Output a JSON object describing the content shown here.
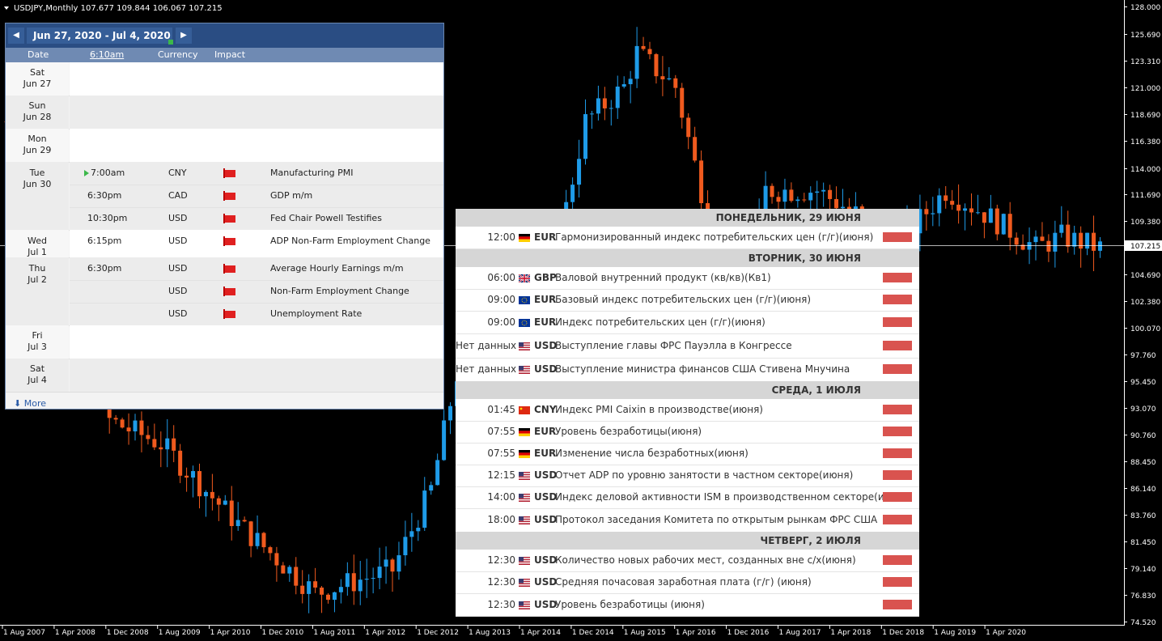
{
  "chart": {
    "header": "USDJPY,Monthly  107.677 109.844 106.067 107.215",
    "current_price": "107.215",
    "price_ticks": [
      "128.000",
      "125.690",
      "123.310",
      "121.000",
      "118.690",
      "116.380",
      "114.000",
      "111.690",
      "109.380",
      "107.215",
      "104.690",
      "102.380",
      "100.070",
      "97.760",
      "95.450",
      "93.070",
      "90.760",
      "88.450",
      "86.140",
      "83.760",
      "81.450",
      "79.140",
      "76.830",
      "74.520"
    ],
    "date_ticks": [
      "1 Aug 2007",
      "1 Apr 2008",
      "1 Dec 2008",
      "1 Aug 2009",
      "1 Apr 2010",
      "1 Dec 2010",
      "1 Aug 2011",
      "1 Apr 2012",
      "1 Dec 2012",
      "1 Aug 2013",
      "1 Apr 2014",
      "1 Dec 2014",
      "1 Aug 2015",
      "1 Apr 2016",
      "1 Dec 2016",
      "1 Aug 2017",
      "1 Apr 2018",
      "1 Dec 2018",
      "1 Aug 2019",
      "1 Apr 2020"
    ],
    "colors": {
      "bull": "#1e9be8",
      "bear": "#f05a1e",
      "price_line": "#ffffff",
      "bg": "#000000"
    }
  },
  "calendar_left": {
    "range": "Jun 27, 2020 - Jul 4, 2020",
    "nav_prev": "◀",
    "nav_next": "▶",
    "columns": {
      "date": "Date",
      "time": "6:10am",
      "currency": "Currency",
      "impact": "Impact"
    },
    "days": [
      {
        "dow": "Sat",
        "date": "Jun 27",
        "events": []
      },
      {
        "dow": "Sun",
        "date": "Jun 28",
        "events": []
      },
      {
        "dow": "Mon",
        "date": "Jun 29",
        "events": []
      },
      {
        "dow": "Tue",
        "date": "Jun 30",
        "events": [
          {
            "time": "7:00am",
            "currency": "CNY",
            "title": "Manufacturing PMI",
            "next": true
          },
          {
            "time": "6:30pm",
            "currency": "CAD",
            "title": "GDP m/m"
          },
          {
            "time": "10:30pm",
            "currency": "USD",
            "title": "Fed Chair Powell Testifies"
          }
        ]
      },
      {
        "dow": "Wed",
        "date": "Jul 1",
        "events": [
          {
            "time": "6:15pm",
            "currency": "USD",
            "title": "ADP Non-Farm Employment Change"
          }
        ]
      },
      {
        "dow": "Thu",
        "date": "Jul 2",
        "events": [
          {
            "time": "6:30pm",
            "currency": "USD",
            "title": "Average Hourly Earnings m/m"
          },
          {
            "time": "",
            "currency": "USD",
            "title": "Non-Farm Employment Change"
          },
          {
            "time": "",
            "currency": "USD",
            "title": "Unemployment Rate"
          }
        ]
      },
      {
        "dow": "Fri",
        "date": "Jul 3",
        "events": []
      },
      {
        "dow": "Sat",
        "date": "Jul 4",
        "events": []
      }
    ],
    "more": "More"
  },
  "calendar_right": {
    "sections": [
      {
        "day": "ПОНЕДЕЛЬНИК, 29 ИЮНЯ",
        "items": [
          {
            "time": "12:00",
            "flag": "de",
            "cur": "EUR",
            "title": "Гармонизированный индекс потребительских цен (г/г)(июня)"
          }
        ]
      },
      {
        "day": "ВТОРНИК, 30 ИЮНЯ",
        "items": [
          {
            "time": "06:00",
            "flag": "gb",
            "cur": "GBP",
            "title": "Валовой внутренний продукт (кв/кв)(Кв1)"
          },
          {
            "time": "09:00",
            "flag": "eu",
            "cur": "EUR",
            "title": "Базовый индекс потребительских цен (г/г)(июня)"
          },
          {
            "time": "09:00",
            "flag": "eu",
            "cur": "EUR",
            "title": "Индекс потребительских цен (г/г)(июня)"
          },
          {
            "time": "Нет данных",
            "flag": "us",
            "cur": "USD",
            "title": "Выступление главы ФРС Пауэлла в Конгрессе"
          },
          {
            "time": "Нет данных",
            "flag": "us",
            "cur": "USD",
            "title": "Выступление министра финансов США Стивена Мнучина"
          }
        ]
      },
      {
        "day": "СРЕДА, 1 ИЮЛЯ",
        "items": [
          {
            "time": "01:45",
            "flag": "cn",
            "cur": "CNY",
            "title": "Индекс PMI Caixin в производстве(июня)"
          },
          {
            "time": "07:55",
            "flag": "de",
            "cur": "EUR",
            "title": "Уровень безработицы(июня)"
          },
          {
            "time": "07:55",
            "flag": "de",
            "cur": "EUR",
            "title": "Изменение числа безработных(июня)"
          },
          {
            "time": "12:15",
            "flag": "us",
            "cur": "USD",
            "title": "Отчет ADP по уровню занятости в частном секторе(июня)"
          },
          {
            "time": "14:00",
            "flag": "us",
            "cur": "USD",
            "title": "Индекс деловой активности ISM в производственном секторе(июня)"
          },
          {
            "time": "18:00",
            "flag": "us",
            "cur": "USD",
            "title": "Протокол заседания Комитета по открытым рынкам ФРС США"
          }
        ]
      },
      {
        "day": "ЧЕТВЕРГ, 2 ИЮЛЯ",
        "items": [
          {
            "time": "12:30",
            "flag": "us",
            "cur": "USD",
            "title": "Количество новых рабочих мест, созданных вне с/х(июня)"
          },
          {
            "time": "12:30",
            "flag": "us",
            "cur": "USD",
            "title": "Средняя почасовая заработная плата (г/г) (июня)"
          },
          {
            "time": "12:30",
            "flag": "us",
            "cur": "USD",
            "title": "Уровень безработицы (июня)"
          }
        ]
      }
    ]
  }
}
